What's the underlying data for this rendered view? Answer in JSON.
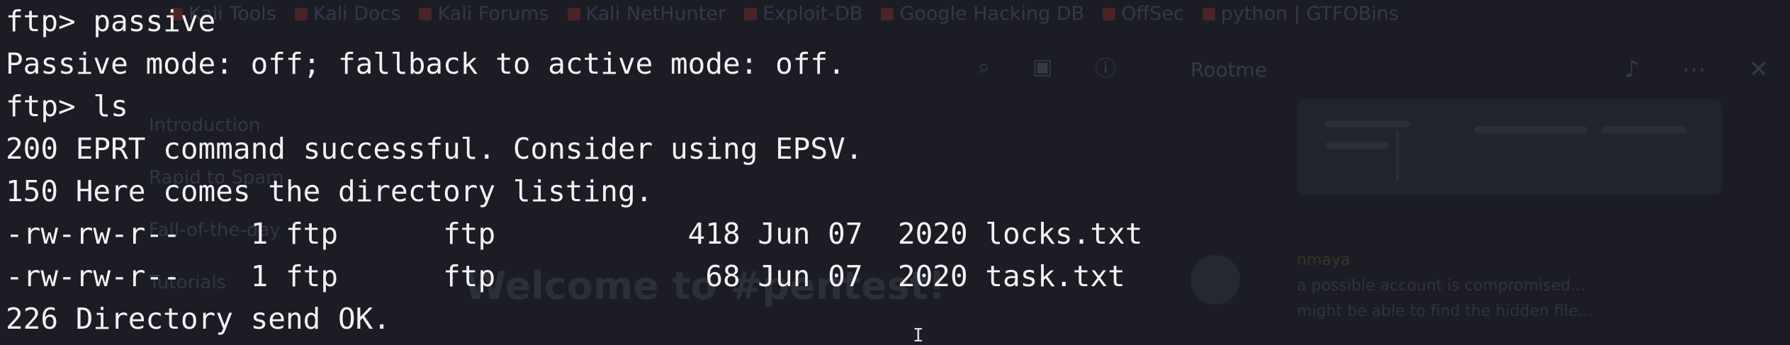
{
  "background": {
    "bookmarks": [
      "Kali Tools",
      "Kali Docs",
      "Kali Forums",
      "Kali NetHunter",
      "Exploit-DB",
      "Google Hacking DB",
      "OffSec",
      "python | GTFOBins"
    ],
    "tab_title": "Rootme",
    "sidebar": [
      "Introduction",
      "Rapid to Spam",
      "Fall-of-the-day",
      "Tutorials"
    ],
    "welcome": "Welcome to #pentest!",
    "chat_name": "nmaya",
    "chat_lines": [
      "a possible account is compromised...",
      "might be able to find the hidden file..."
    ]
  },
  "terminal": {
    "lines": [
      "ftp> passive",
      "Passive mode: off; fallback to active mode: off.",
      "ftp> ls",
      "200 EPRT command successful. Consider using EPSV.",
      "150 Here comes the directory listing.",
      "-rw-rw-r--    1 ftp      ftp           418 Jun 07  2020 locks.txt",
      "-rw-rw-r--    1 ftp      ftp            68 Jun 07  2020 task.txt",
      "226 Directory send OK."
    ]
  },
  "cursor_glyph": "I",
  "colors": {
    "terminal_bg": "#1b1c24",
    "terminal_fg": "#f2f2f2"
  }
}
